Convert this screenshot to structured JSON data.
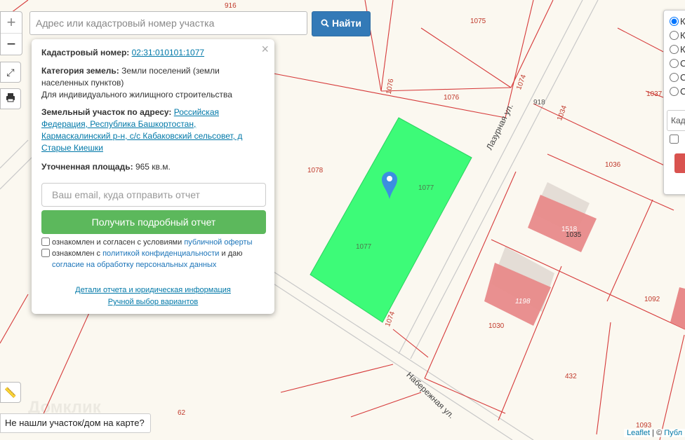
{
  "map": {
    "parcel_labels": [
      "916",
      "1075",
      "1076",
      "1076",
      "1074",
      "918",
      "1037",
      "1034",
      "1078",
      "1077",
      "1077",
      "1036",
      "1518",
      "1035",
      "1198",
      "1030",
      "1092",
      "1074",
      "432",
      "62",
      "1093"
    ],
    "streets": {
      "lazurnaya": "Лазурная ул.",
      "naberezhnaya": "Набережная ул."
    },
    "watermark": "Домклик",
    "selected_parcel_color": "#3dfb78"
  },
  "zoom": {
    "in": "+",
    "out": "−"
  },
  "search": {
    "placeholder": "Адрес или кадастровый номер участка",
    "button": "Найти"
  },
  "popup": {
    "cadastral_label": "Кадастровый номер:",
    "cadastral_number": "02:31:010101:1077",
    "category_label": "Категория земель:",
    "category_value": "Земли поселений (земли населенных пунктов)",
    "usage": "Для индивидуального жилищного строительства",
    "address_label": "Земельный участок по адресу:",
    "address_value": "Российская Федерация, Республика Башкортостан, Кармаскалинский р-н, с/с Кабаковский сельсовет, д Старые Киешки",
    "area_label": "Уточненная площадь:",
    "area_value": "965 кв.м.",
    "email_placeholder": "Ваш email, куда отправить отчет",
    "report_button": "Получить подробный отчет",
    "consent1_text": "ознакомлен и согласен с условиями ",
    "consent1_link": "публичной оферты",
    "consent2_text": "ознакомлен с ",
    "consent2_link": "политикой конфиденциальности",
    "consent2_mid": " и даю",
    "consent2_link2": "согласие на обработку персональных данных",
    "details_link": "Детали отчета и юридическая информация",
    "manual_link": "Ручной выбор вариантов"
  },
  "layers": {
    "options": [
      "К",
      "К",
      "К",
      "С",
      "С",
      "С"
    ],
    "select_value": "Када"
  },
  "bottom_note": "Не нашли участок/дом на карте?",
  "attribution": {
    "leaflet": "Leaflet",
    "sep": " | © ",
    "rest": "Публ"
  }
}
